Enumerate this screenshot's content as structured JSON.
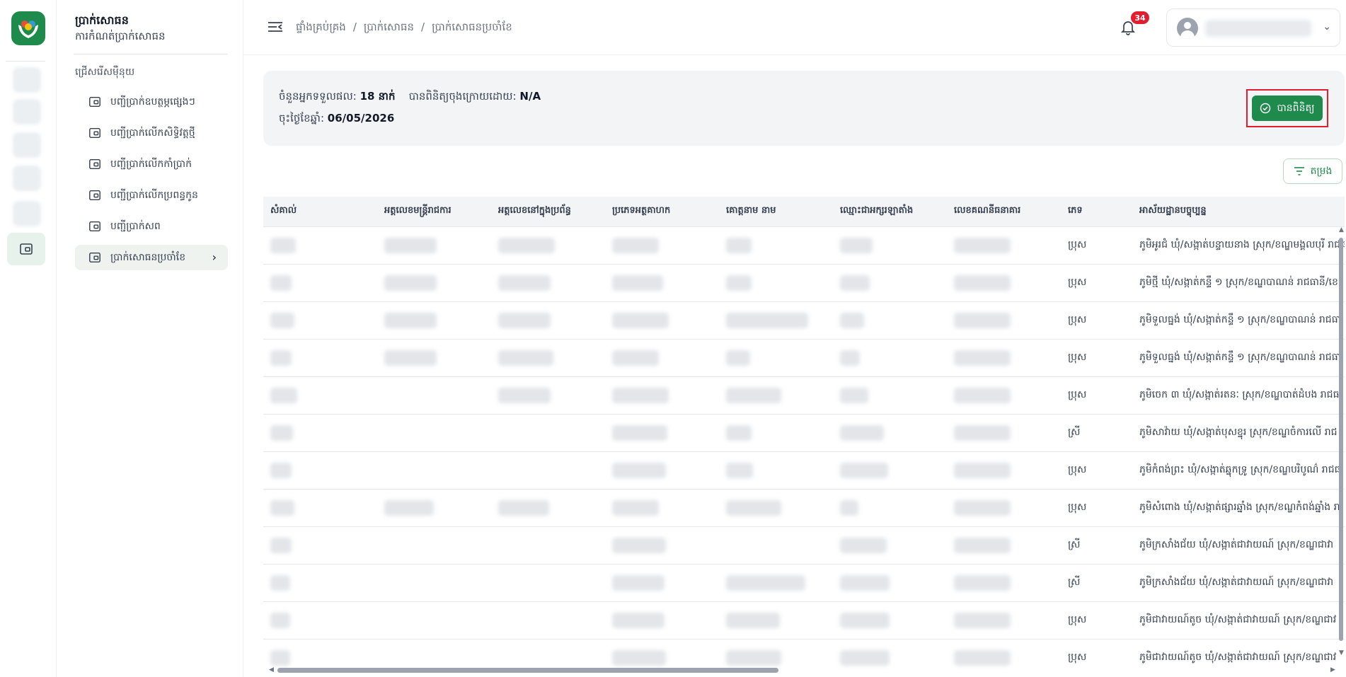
{
  "app": {
    "title": "ប្រាក់សោធន",
    "subtitle": "ការកំណត់ប្រាក់សោធន",
    "brand_color": "#1e8a4c"
  },
  "sidebar": {
    "section_label": "ជ្រើសរើសម៉ឺនុយ",
    "items": [
      {
        "label": "បញ្ជីប្រាក់ឧបត្ថម្ភផ្សេងៗ",
        "icon": "wallet-icon"
      },
      {
        "label": "បញ្ជីប្រាក់លើកសិទ្ធិវត្តថ្មី",
        "icon": "wallet-icon"
      },
      {
        "label": "បញ្ជីប្រាក់លើកកាំប្រាក់",
        "icon": "wallet-icon"
      },
      {
        "label": "បញ្ជីប្រាក់លើកប្រពន្ធកូន",
        "icon": "wallet-icon"
      },
      {
        "label": "បញ្ជីប្រាក់សព",
        "icon": "wallet-icon"
      },
      {
        "label": "ប្រាក់សោធនប្រចាំខែ",
        "icon": "wallet-icon",
        "active": true
      }
    ]
  },
  "header": {
    "breadcrumbs": [
      "ផ្ទាំងគ្រប់គ្រង",
      "ប្រាក់សោធន",
      "ប្រាក់សោធនប្រចាំខែ"
    ],
    "separator": "/",
    "notification_count": "34"
  },
  "info": {
    "recipients_label": "ចំនួនអ្នកទទួលផល:",
    "recipients_value": "18 នាក់",
    "verified_by_label": "បានពិនិត្យចុងក្រោយដោយ:",
    "verified_by_value": "N/A",
    "date_label": "ចុះថ្ងៃខែឆ្នាំ:",
    "date_value": "06/05/2026",
    "verify_button": "បានពិនិត្យ"
  },
  "filter_button": "តម្រង",
  "table": {
    "columns": [
      "សំគាល់",
      "អត្តលេខមន្ត្រីរាជការ",
      "អត្តលេខនៅក្នុងប្រព័ន្ធ",
      "ប្រភេទអត្ថគាហក",
      "គោត្តនាម នាម",
      "ឈ្មោះជាអក្សរឡាតាំង",
      "លេខគណនីធនាគារ",
      "ភេទ",
      "អាស័យដ្ឋានបច្ចុប្បន្ន"
    ],
    "rows": [
      {
        "gender": "ប្រុស",
        "address": "ភូមិអូរជំ ឃុំ/សង្កាត់បន្ទាយនាង ស្រុក/ខណ្ឌមង្គលបុរី រាជធ"
      },
      {
        "gender": "ប្រុស",
        "address": "ភូមិថ្មី ឃុំ/សង្កាត់កន្ទឹ ១ ស្រុក/ខណ្ឌបាណន់ រាជធានី/ខេ"
      },
      {
        "gender": "ប្រុស",
        "address": "ភូមិទួលធ្នង់ ឃុំ/សង្កាត់កន្ទឹ ១ ស្រុក/ខណ្ឌបាណន់ រាជធា"
      },
      {
        "gender": "ប្រុស",
        "address": "ភូមិទួលធ្នង់ ឃុំ/សង្កាត់កន្ទឹ ១ ស្រុក/ខណ្ឌបាណន់ រាជធា"
      },
      {
        "gender": "ប្រុស",
        "address": "ភូមិចេក ៣ ឃុំ/សង្កាត់រតនៈ ស្រុក/ខណ្ឌបាត់ដំបង រាជធ"
      },
      {
        "gender": "ស្រី",
        "address": "ភូមិសាវ៉ាយ ឃុំ/សង្កាត់បុសខ្នុរ ស្រុក/ខណ្ឌចំការលើ រាជ"
      },
      {
        "gender": "ប្រុស",
        "address": "ភូមិកំពង់ព្រះ ឃុំ/សង្កាត់ឆ្នុកទ្រូ ស្រុក/ខណ្ឌបរិបូណ៌ រាជធ"
      },
      {
        "gender": "ប្រុស",
        "address": "ភូមិសំពោង ឃុំ/សង្កាត់ផ្សារឆ្នាំង ស្រុក/ខណ្ឌកំពង់ឆ្នាំង រា"
      },
      {
        "gender": "ស្រី",
        "address": "ភូមិក្រសាំងជ័យ ឃុំ/សង្កាត់ជាវាយណ៍ ស្រុក/ខណ្ឌជាវា"
      },
      {
        "gender": "ស្រី",
        "address": "ភូមិក្រសាំងជ័យ ឃុំ/សង្កាត់ជាវាយណ៍ ស្រុក/ខណ្ឌជាវា"
      },
      {
        "gender": "ប្រុស",
        "address": "ភូមិជាវាយណ៍តូច ឃុំ/សង្កាត់ជាវាយណ៍ ស្រុក/ខណ្ឌជាវ"
      },
      {
        "gender": "ប្រុស",
        "address": "ភូមិជាវាយណ៍តូច ឃុំ/សង្កាត់ជាវាយណ៍ ស្រុក/ខណ្ឌជាវ"
      }
    ]
  }
}
